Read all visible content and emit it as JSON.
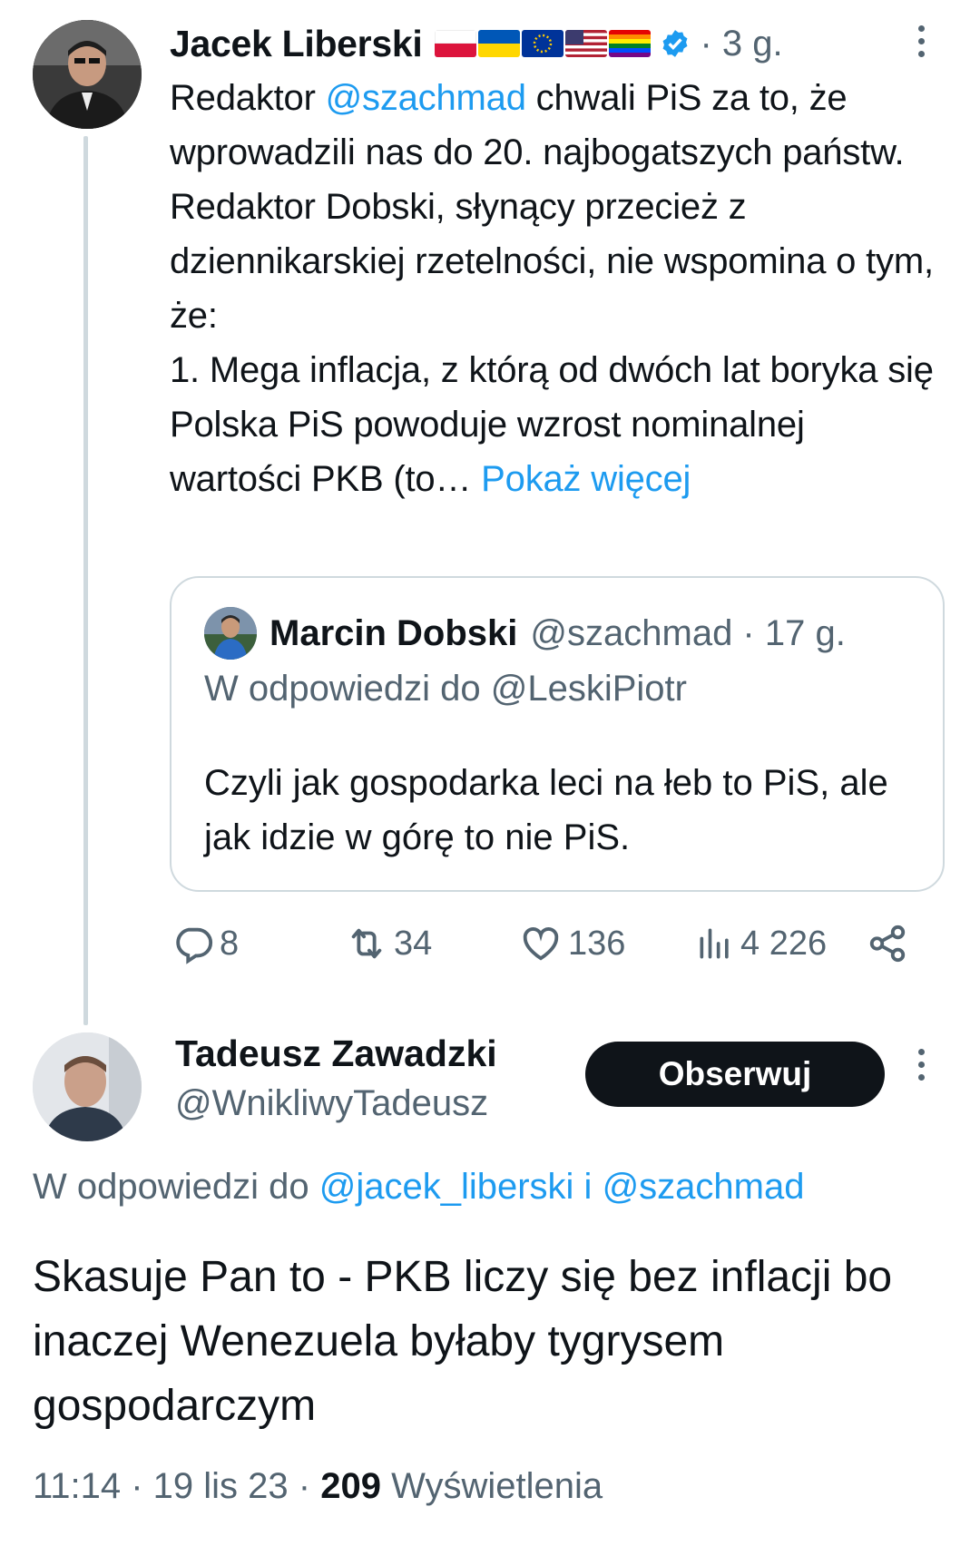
{
  "tweet1": {
    "author_name": "Jacek Liberski",
    "flags": [
      "flag-poland-icon",
      "flag-ukraine-icon",
      "flag-eu-icon",
      "flag-usa-icon",
      "flag-rainbow-icon"
    ],
    "verified": true,
    "time": "· 3 g.",
    "text_pre": "Redaktor ",
    "mention": "@szachmad",
    "text_main": " chwali PiS za to, że wprowadzili nas do 20. najbogatszych państw. Redaktor Dobski, słynący przecież z dziennikarskiej rzetelności, nie wspomina o tym, że:",
    "text_point": "1. Mega inflacja, z którą od dwóch lat boryka się Polska PiS powoduje wzrost nominalnej wartości PKB (to… ",
    "show_more": "Pokaż więcej",
    "quote": {
      "author_name": "Marcin Dobski",
      "handle_time": "@szachmad · 17 g.",
      "reply_to": "W odpowiedzi do @LeskiPiotr",
      "text": "Czyli jak gospodarka leci na łeb to PiS, ale jak idzie w górę to nie PiS."
    },
    "actions": {
      "replies": "8",
      "retweets": "34",
      "likes": "136",
      "views": "4 226"
    }
  },
  "tweet2": {
    "author_name": "Tadeusz Zawadzki",
    "handle": "@WnikliwyTadeusz",
    "follow_label": "Obserwuj",
    "reply_prefix": "W odpowiedzi do ",
    "reply_mention1": "@jacek_liberski",
    "reply_joiner": " i ",
    "reply_mention2": "@szachmad",
    "text": "Skasuje Pan to - PKB liczy się bez inflacji bo inaczej Wenezuela byłaby tygrysem gospodarczym",
    "timestamp": "11:14 · 19 lis 23 · ",
    "views_count": "209",
    "views_label": " Wyświetlenia"
  },
  "colors": {
    "link": "#1d9bf0",
    "secondary_text": "#536471",
    "primary_text": "#0f1419",
    "border": "#cfd9de"
  }
}
